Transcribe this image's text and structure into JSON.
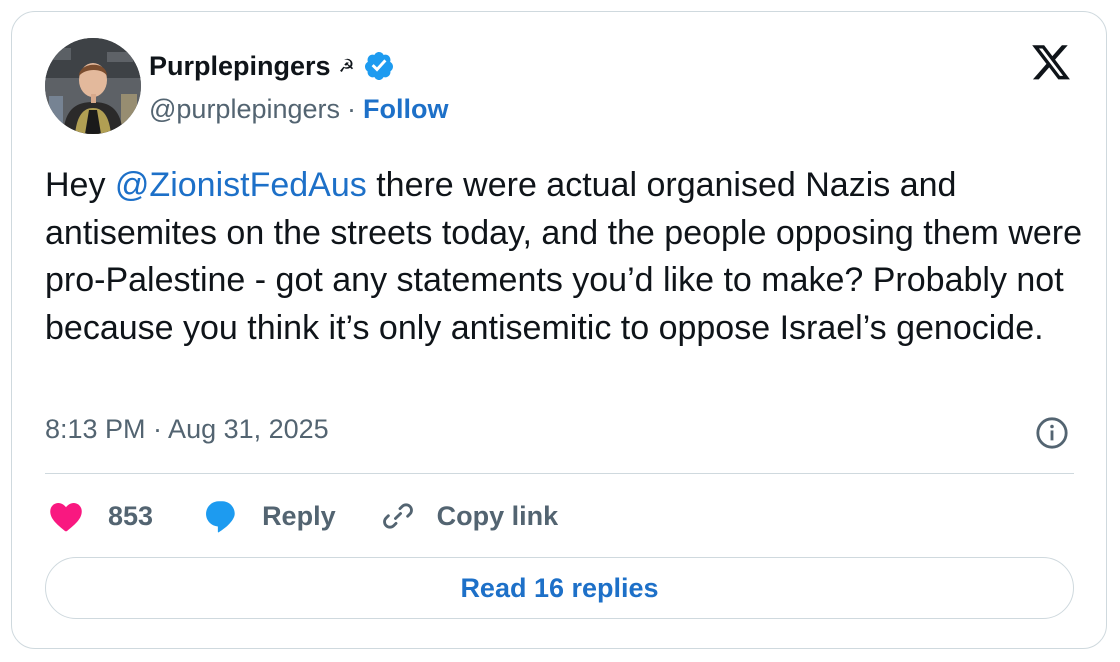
{
  "author": {
    "display_name": "Purplepingers",
    "name_emoji": "☭",
    "handle": "@purplepingers",
    "separator": "·",
    "follow_label": "Follow",
    "avatar_icon": "profile-photo"
  },
  "tweet": {
    "text_prefix": "Hey ",
    "mention": "@ZionistFedAus",
    "text_rest": " there were actual organised Nazis and antisemites on the streets today, and the people opposing them were pro-Palestine - got any statements you’d like to make? Probably not because you think it’s only antisemitic to oppose Israel’s genocide.",
    "timestamp": "8:13 PM · Aug 31, 2025"
  },
  "actions": {
    "like_count": "853",
    "reply_label": "Reply",
    "copy_label": "Copy link"
  },
  "read_replies_label": "Read 16 replies",
  "colors": {
    "link_blue": "#1d70c8",
    "verified_blue": "#1d9bf0",
    "like_pink": "#f91880",
    "reply_blue": "#1d9bf0",
    "muted_gray": "#536471",
    "border": "#cfd9de"
  },
  "icons": {
    "brand": "x-logo-icon",
    "verified": "verified-badge-icon",
    "info": "info-icon",
    "like": "heart-icon",
    "reply": "speech-bubble-icon",
    "copy": "link-icon"
  }
}
